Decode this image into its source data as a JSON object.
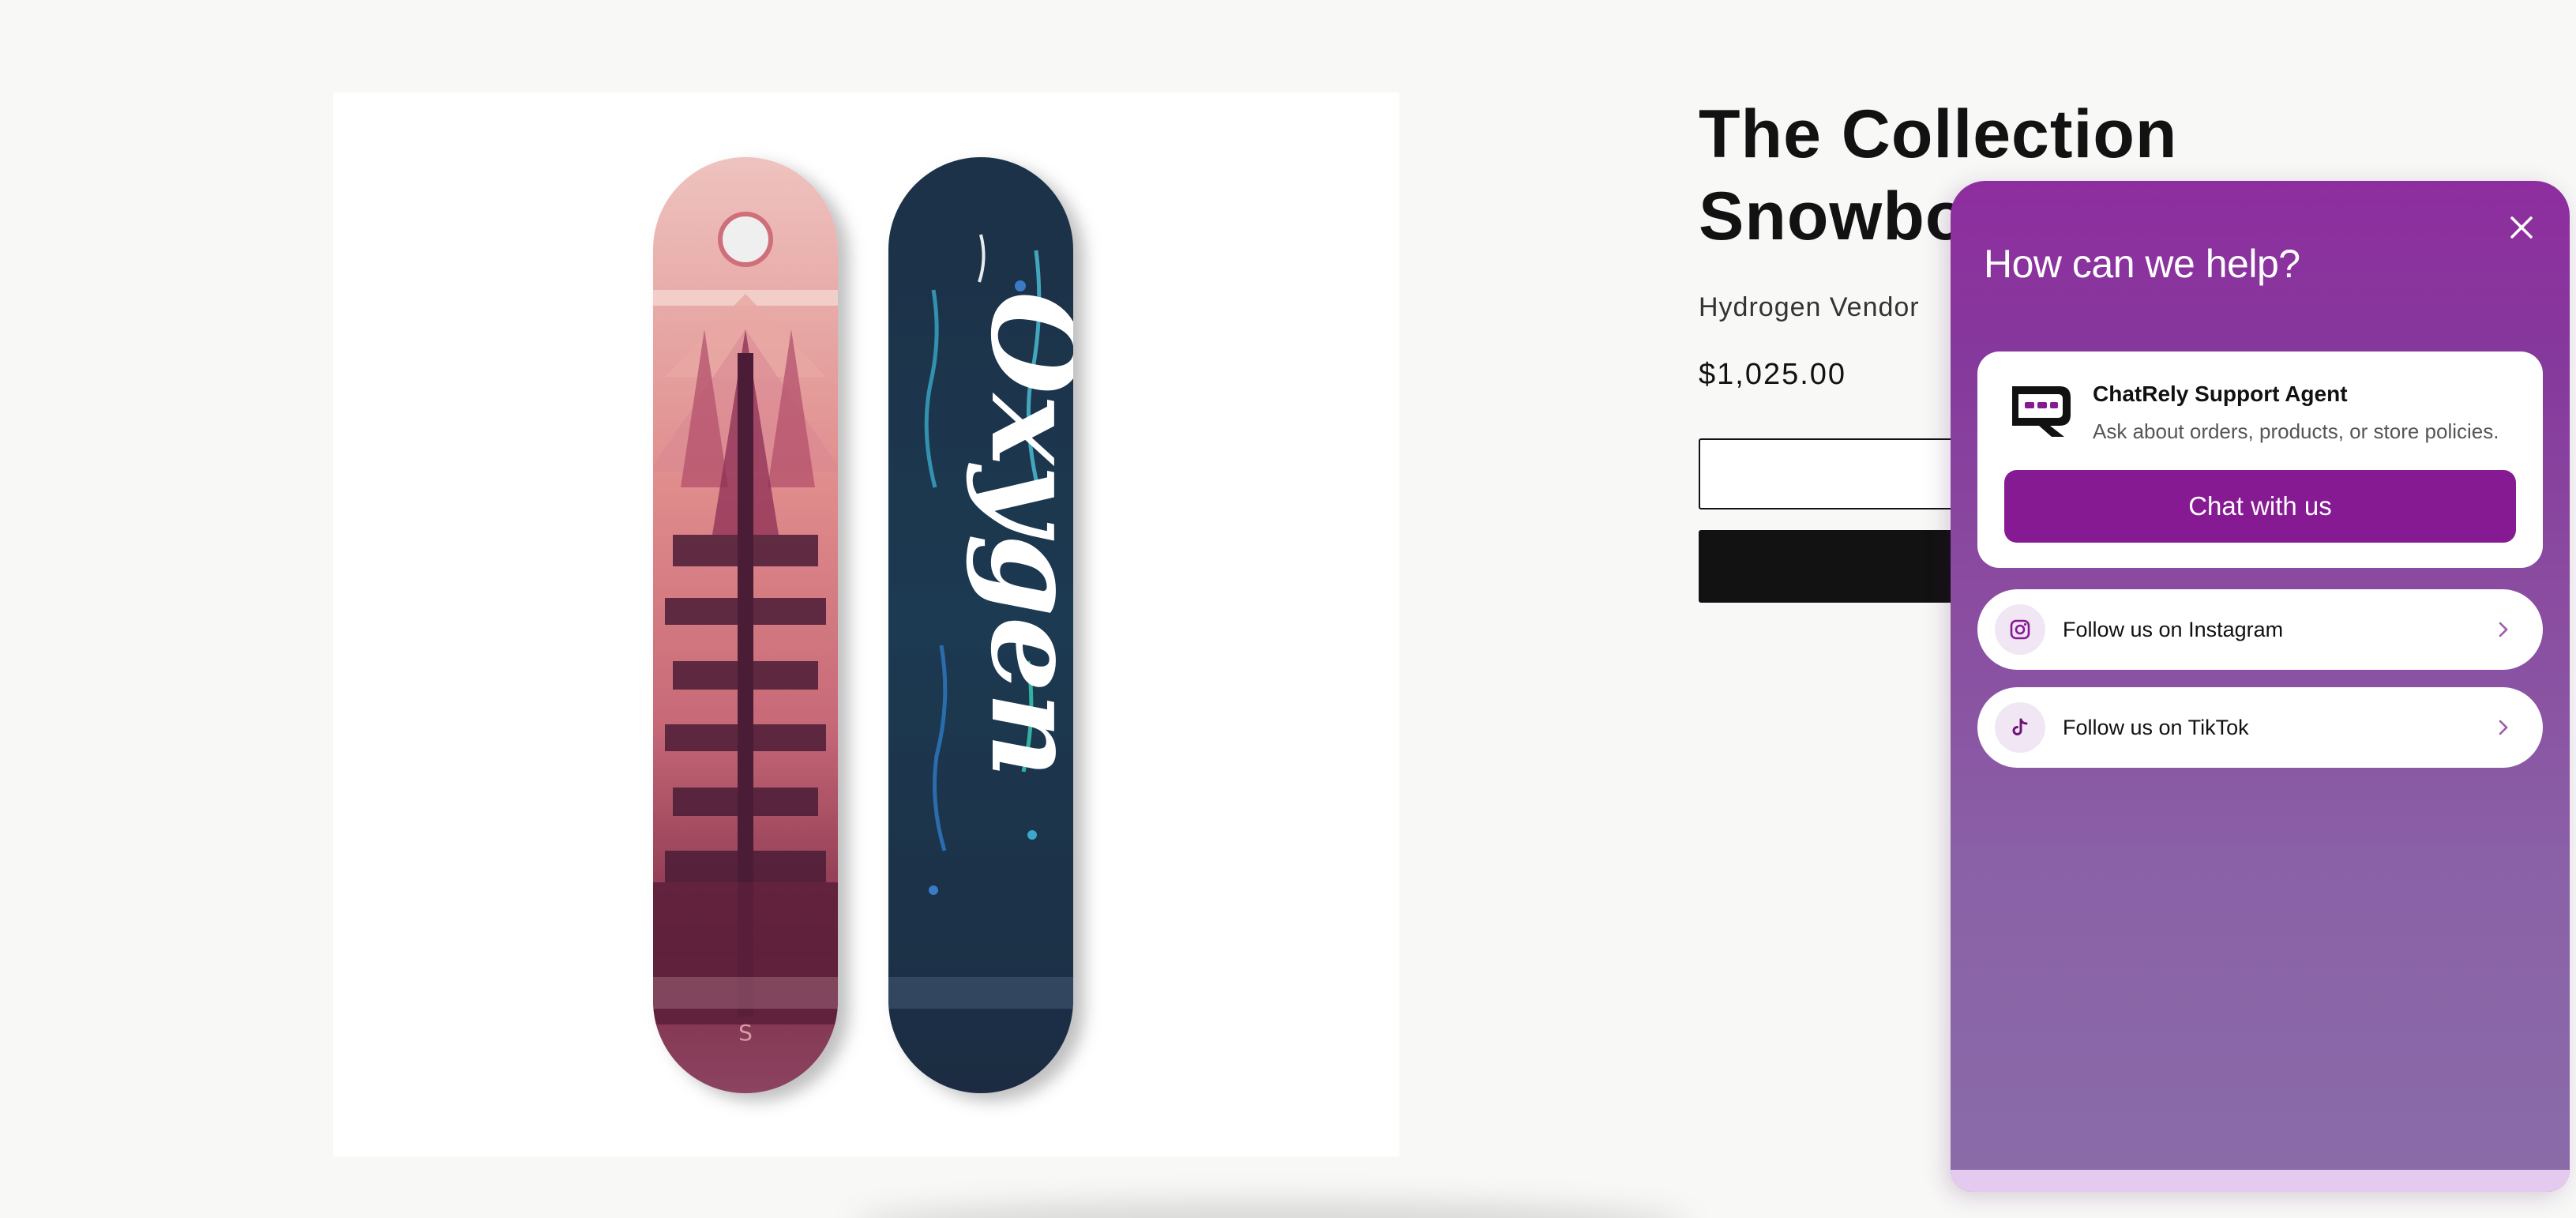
{
  "product": {
    "title": "The Collection Snowboard: Oxygen",
    "title_line1": "The Collection",
    "title_line2": "Snowbo",
    "vendor": "Hydrogen Vendor",
    "price": "$1,025.00",
    "board_text": "Oxygen"
  },
  "help_widget": {
    "heading": "How can we help?",
    "agent": {
      "name": "ChatRely Support Agent",
      "description": "Ask about orders, products, or store policies.",
      "chat_button": "Chat with us"
    },
    "links": [
      {
        "label": "Follow us on Instagram",
        "icon": "instagram-icon"
      },
      {
        "label": "Follow us on TikTok",
        "icon": "tiktok-icon"
      }
    ]
  },
  "colors": {
    "brand_purple": "#861a93",
    "widget_gradient_top": "#8e2d9f",
    "widget_gradient_bottom": "#8a6ca8",
    "page_background": "#f8f8f7"
  }
}
